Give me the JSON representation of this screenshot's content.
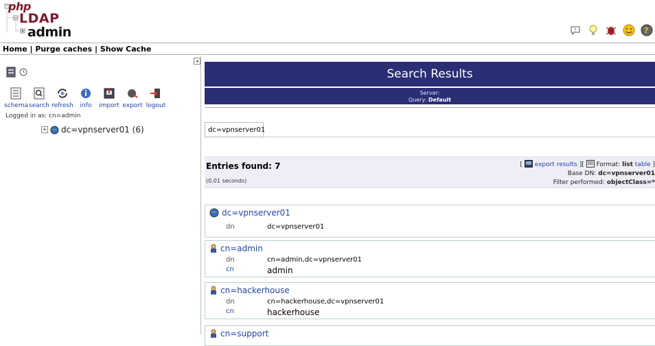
{
  "header": {
    "logo": {
      "php": "php",
      "ldap": "LDAP",
      "admin": "admin"
    },
    "icons": [
      "speech-bubble-icon",
      "lightbulb-icon",
      "bug-icon",
      "smiley-icon",
      "help-icon"
    ]
  },
  "menu": {
    "home": "Home",
    "sep1": " | ",
    "purge": "Purge caches",
    "sep2": " | ",
    "show": "Show Cache"
  },
  "left": {
    "tools": [
      {
        "icon": "schema-icon",
        "label": "schema"
      },
      {
        "icon": "search-icon",
        "label": "search"
      },
      {
        "icon": "refresh-icon",
        "label": "refresh"
      },
      {
        "icon": "info-icon",
        "label": "info"
      },
      {
        "icon": "import-icon",
        "label": "import"
      },
      {
        "icon": "export-icon",
        "label": "export"
      },
      {
        "icon": "logout-icon",
        "label": "logout"
      }
    ],
    "logged_in": "Logged in as: cn=admin",
    "tree_node": "dc=vpnserver01 (6)"
  },
  "results": {
    "title": "Search Results",
    "server_label": "Server:",
    "query_label": "Query:",
    "query_value": "Default",
    "base_tab": "dc=vpnserver01",
    "entries_found_label": "Entries found:",
    "entries_found_value": "7",
    "seconds": "(0.01 seconds)",
    "export_link": "export results",
    "format_label": "Format:",
    "format_list": "list",
    "format_table": "table",
    "base_dn_label": "Base DN:",
    "base_dn_value": "dc=vpnserver01",
    "filter_label": "Filter performed:",
    "filter_value": "objectClass=*",
    "entries": [
      {
        "title": "dc=vpnserver01",
        "icon": "globe-icon",
        "attrs": [
          {
            "name": "dn",
            "value": "dc=vpnserver01"
          }
        ]
      },
      {
        "title": "cn=admin",
        "icon": "user-icon",
        "attrs": [
          {
            "name": "dn",
            "value": "cn=admin,dc=vpnserver01"
          },
          {
            "name": "cn",
            "value": "admin"
          }
        ]
      },
      {
        "title": "cn=hackerhouse",
        "icon": "user-icon",
        "attrs": [
          {
            "name": "dn",
            "value": "cn=hackerhouse,dc=vpnserver01"
          },
          {
            "name": "cn",
            "value": "hackerhouse"
          }
        ]
      },
      {
        "title": "cn=support",
        "icon": "user-icon",
        "attrs": []
      }
    ]
  }
}
